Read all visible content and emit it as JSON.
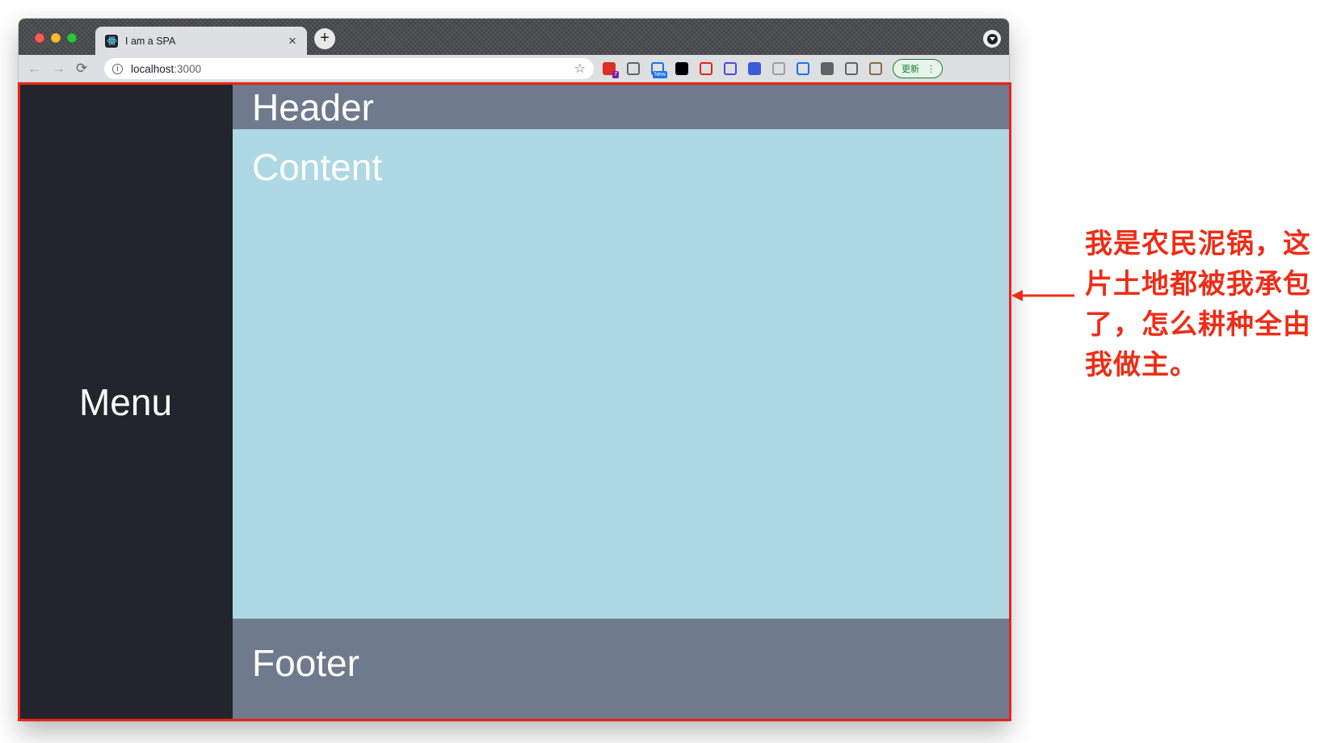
{
  "browser": {
    "tab": {
      "title": "I am a SPA",
      "close_glyph": "×"
    },
    "new_tab_glyph": "+",
    "address_bar": {
      "host": "localhost",
      "port": ":3000"
    },
    "update_button": {
      "label": "更新",
      "menu_glyph": "⋮"
    },
    "extensions": [
      {
        "name": "tabs-badge-extension-icon",
        "color": "#d93025",
        "badge": "7"
      },
      {
        "name": "eyedropper-extension-icon",
        "color": "#5f6368",
        "badge": ""
      },
      {
        "name": "new-badge-extension-icon",
        "color": "#1a73e8",
        "badge": "New"
      },
      {
        "name": "square-extension-icon",
        "color": "#000000",
        "badge": ""
      },
      {
        "name": "red-o-extension-icon",
        "color": "#e8231a",
        "badge": ""
      },
      {
        "name": "purple-drop-extension-icon",
        "color": "#4f46e5",
        "badge": ""
      },
      {
        "name": "window-extension-icon",
        "color": "#3b5bdb",
        "badge": ""
      },
      {
        "name": "y-extension-icon",
        "color": "#9aa0a6",
        "badge": ""
      },
      {
        "name": "download-extension-icon",
        "color": "#1a73e8",
        "badge": ""
      },
      {
        "name": "chart-extension-icon",
        "color": "#5f6368",
        "badge": ""
      },
      {
        "name": "puzzle-extension-icon",
        "color": "#5f6368",
        "badge": ""
      },
      {
        "name": "avatar-extension-icon",
        "color": "#8a6d3b",
        "badge": ""
      }
    ]
  },
  "page": {
    "menu": "Menu",
    "header": "Header",
    "content": "Content",
    "footer": "Footer"
  },
  "colors": {
    "menu_bg": "#22252b",
    "header_bg": "#6f7b8c",
    "content_bg": "#add8e4",
    "footer_bg": "#6f7b8c",
    "annotation": "#ee2d17"
  },
  "annotation": {
    "lines": [
      "我是农民泥锅，这",
      "片土地都被我承包",
      "了，怎么耕种全由",
      "我做主。"
    ]
  }
}
